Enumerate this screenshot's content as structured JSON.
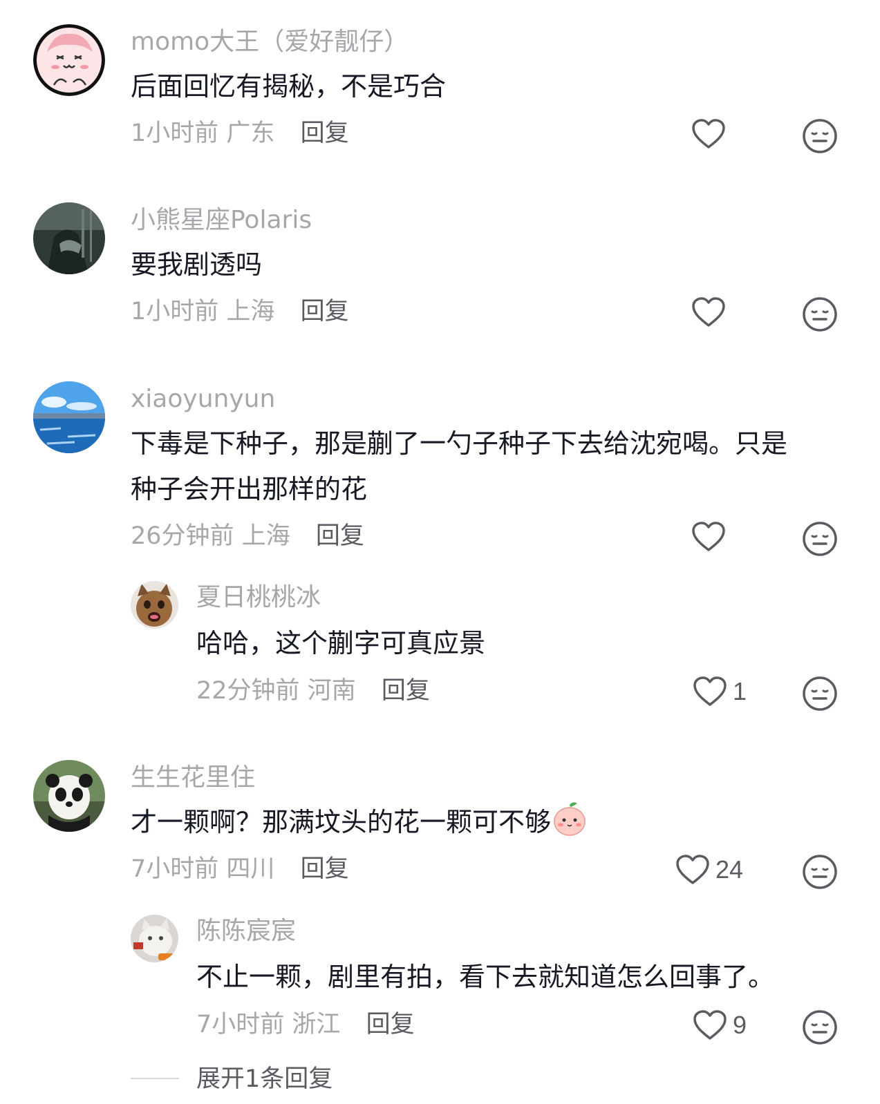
{
  "comments": [
    {
      "name": "momo大王（爱好靓仔）",
      "text": "后面回忆有揭秘，不是巧合",
      "time": "1小时前",
      "location": "广东",
      "reply_label": "回复",
      "likes": ""
    },
    {
      "name": "小熊星座Polaris",
      "text": "要我剧透吗",
      "time": "1小时前",
      "location": "上海",
      "reply_label": "回复",
      "likes": ""
    },
    {
      "name": "xiaoyunyun",
      "text_line1": "下毒是下种子，那是蒯了一勺子种子下去给沈宛喝。只是",
      "text_line2": "种子会开出那样的花",
      "time": "26分钟前",
      "location": "上海",
      "reply_label": "回复",
      "likes": "",
      "replies": [
        {
          "name": "夏日桃桃冰",
          "text": "哈哈，这个蒯字可真应景",
          "time": "22分钟前",
          "location": "河南",
          "reply_label": "回复",
          "likes": "1"
        }
      ]
    },
    {
      "name": "生生花里住",
      "text": "才一颗啊？那满坟头的花一颗可不够",
      "time": "7小时前",
      "location": "四川",
      "reply_label": "回复",
      "likes": "24",
      "replies": [
        {
          "name": "陈陈宸宸",
          "text": "不止一颗，剧里有拍，看下去就知道怎么回事了。",
          "time": "7小时前",
          "location": "浙江",
          "reply_label": "回复",
          "likes": "9"
        }
      ]
    }
  ],
  "expand_label": "展开1条回复",
  "icons": {
    "like": "heart-outline-icon",
    "dislike": "neutral-face-icon",
    "emoji": "peach-face-emoji"
  },
  "colors": {
    "name": "#a6a7ab",
    "text": "#161823",
    "reply": "#5a5b61"
  }
}
